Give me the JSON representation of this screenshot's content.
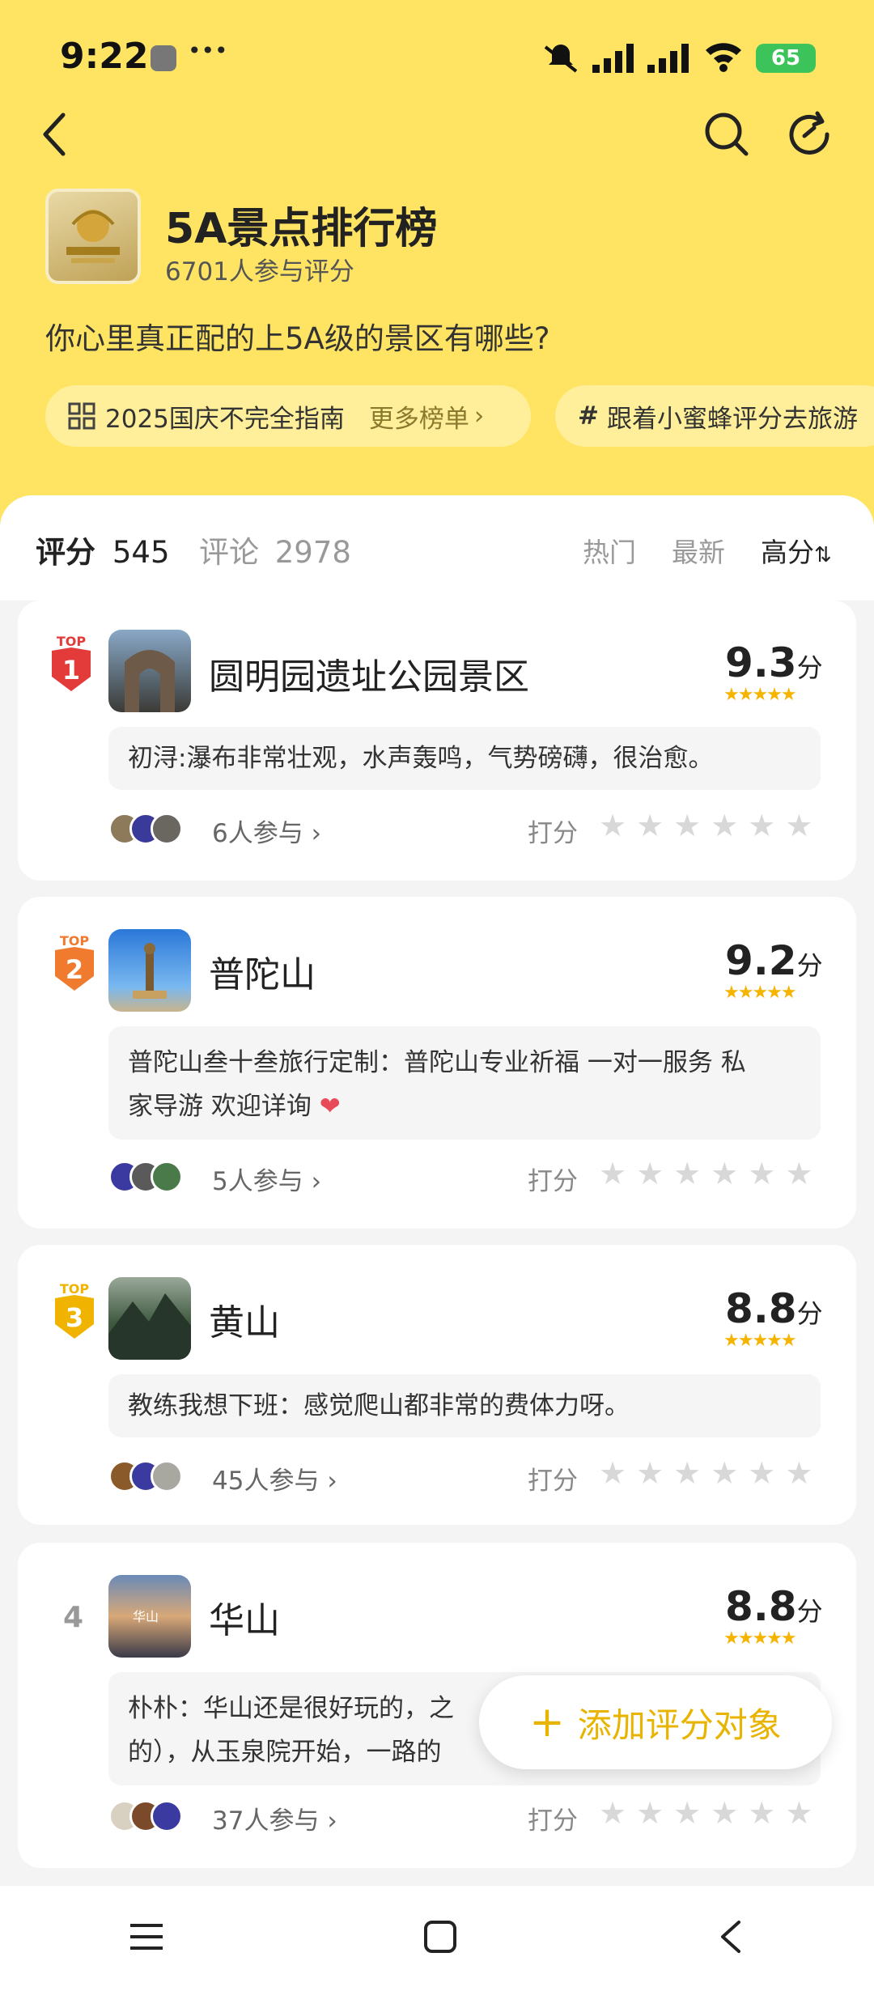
{
  "status_bar": {
    "time": "9:22",
    "extra": "•••",
    "battery": "65"
  },
  "header": {
    "back_icon": "chevron-left-icon",
    "search_icon": "search-icon",
    "share_icon": "refresh-share-icon"
  },
  "list": {
    "title": "5A景点排行榜",
    "subtitle": "6701人参与评分",
    "question": "你心里真正配的上5A级的景区有哪些?",
    "pill_guide": "2025国庆不完全指南",
    "pill_more": "更多榜单",
    "pill_topic": "跟着小蜜蜂评分去旅游"
  },
  "tabs": {
    "rating_label": "评分",
    "rating_count": "545",
    "comment_label": "评论",
    "comment_count": "2978",
    "sort_hot": "热门",
    "sort_new": "最新",
    "sort_high": "高分"
  },
  "items": [
    {
      "rank": "1",
      "name": "圆明园遗址公园景区",
      "score": "9.3",
      "unit": "分",
      "comment": "初浔:瀑布非常壮观，水声轰鸣，气势磅礴，很治愈。",
      "participants": "6人参与",
      "rate_label": "打分"
    },
    {
      "rank": "2",
      "name": "普陀山",
      "score": "9.2",
      "unit": "分",
      "comment_line1": "普陀山叁十叁旅行定制：普陀山专业祈福 一对一服务 私",
      "comment_line2": "家导游 欢迎详询",
      "participants": "5人参与",
      "rate_label": "打分"
    },
    {
      "rank": "3",
      "name": "黄山",
      "score": "8.8",
      "unit": "分",
      "comment": "教练我想下班：感觉爬山都非常的费体力呀。",
      "participants": "45人参与",
      "rate_label": "打分"
    },
    {
      "rank": "4",
      "name": "华山",
      "score": "8.8",
      "unit": "分",
      "comment_line1": "朴朴：华山还是很好玩的，之",
      "comment_line2": "的），从玉泉院开始，一路的",
      "participants": "37人参与",
      "rate_label": "打分",
      "thumb_text": "华山"
    }
  ],
  "top_label": "TOP",
  "fab": {
    "label": "添加评分对象"
  },
  "colors": {
    "accent": "#ffe463",
    "star": "#f5b400",
    "fab_text": "#e8b400"
  }
}
